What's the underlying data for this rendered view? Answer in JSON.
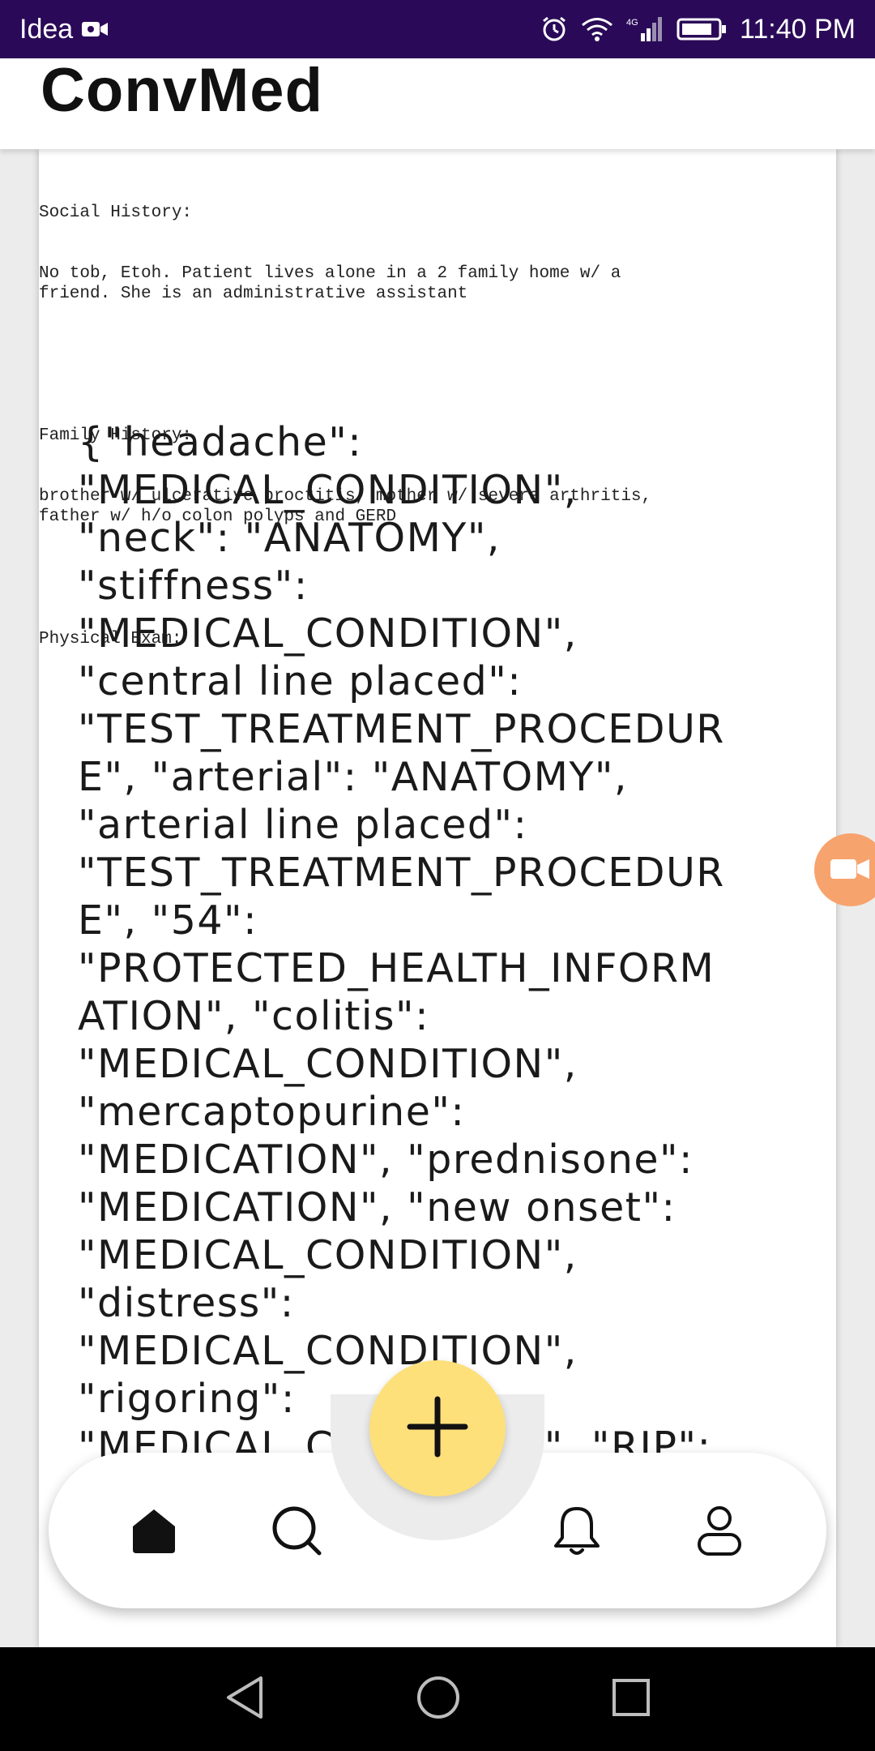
{
  "status_bar": {
    "carrier": "Idea",
    "network_label": "4G",
    "time": "11:40 PM"
  },
  "app": {
    "title": "ConvMed"
  },
  "document": {
    "social_history_heading": "Social History:",
    "social_history_text": "No tob, Etoh. Patient lives alone in a 2 family home w/ a\nfriend. She is an administrative assistant",
    "family_history_heading": "Family History:",
    "family_history_text": "brother w/ ulcerative proctitis, mother w/ severe arthritis,\nfather w/ h/o colon polyps and GERD",
    "physical_exam_heading": "Physical Exam:"
  },
  "result": {
    "json_text": "{\"headache\": \"MEDICAL_CONDITION\", \"neck\": \"ANATOMY\", \"stiffness\": \"MEDICAL_CONDITION\", \"central line placed\": \"TEST_TREATMENT_PROCEDURE\", \"arterial\": \"ANATOMY\", \"arterial line placed\": \"TEST_TREATMENT_PROCEDURE\", \"54\": \"PROTECTED_HEALTH_INFORMATION\", \"colitis\": \"MEDICAL_CONDITION\", \"mercaptopurine\": \"MEDICATION\", \"prednisone\": \"MEDICATION\", \"new onset\": \"MEDICAL_CONDITION\", \"distress\": \"MEDICAL_CONDITION\", \"rigoring\": \"MEDICAL_CONDITION\", \"RIP\": \"...\", \"headaches\": \"MEDICAL_CONDITION\""
  },
  "bottom_nav": {
    "items": [
      "home-icon",
      "search-icon",
      "bell-icon",
      "profile-icon"
    ],
    "fab_icon": "plus-icon"
  },
  "colors": {
    "status_bar_bg": "#2a0a58",
    "fab_bg": "#fde07a",
    "record_button_bg": "#f7a36e"
  }
}
